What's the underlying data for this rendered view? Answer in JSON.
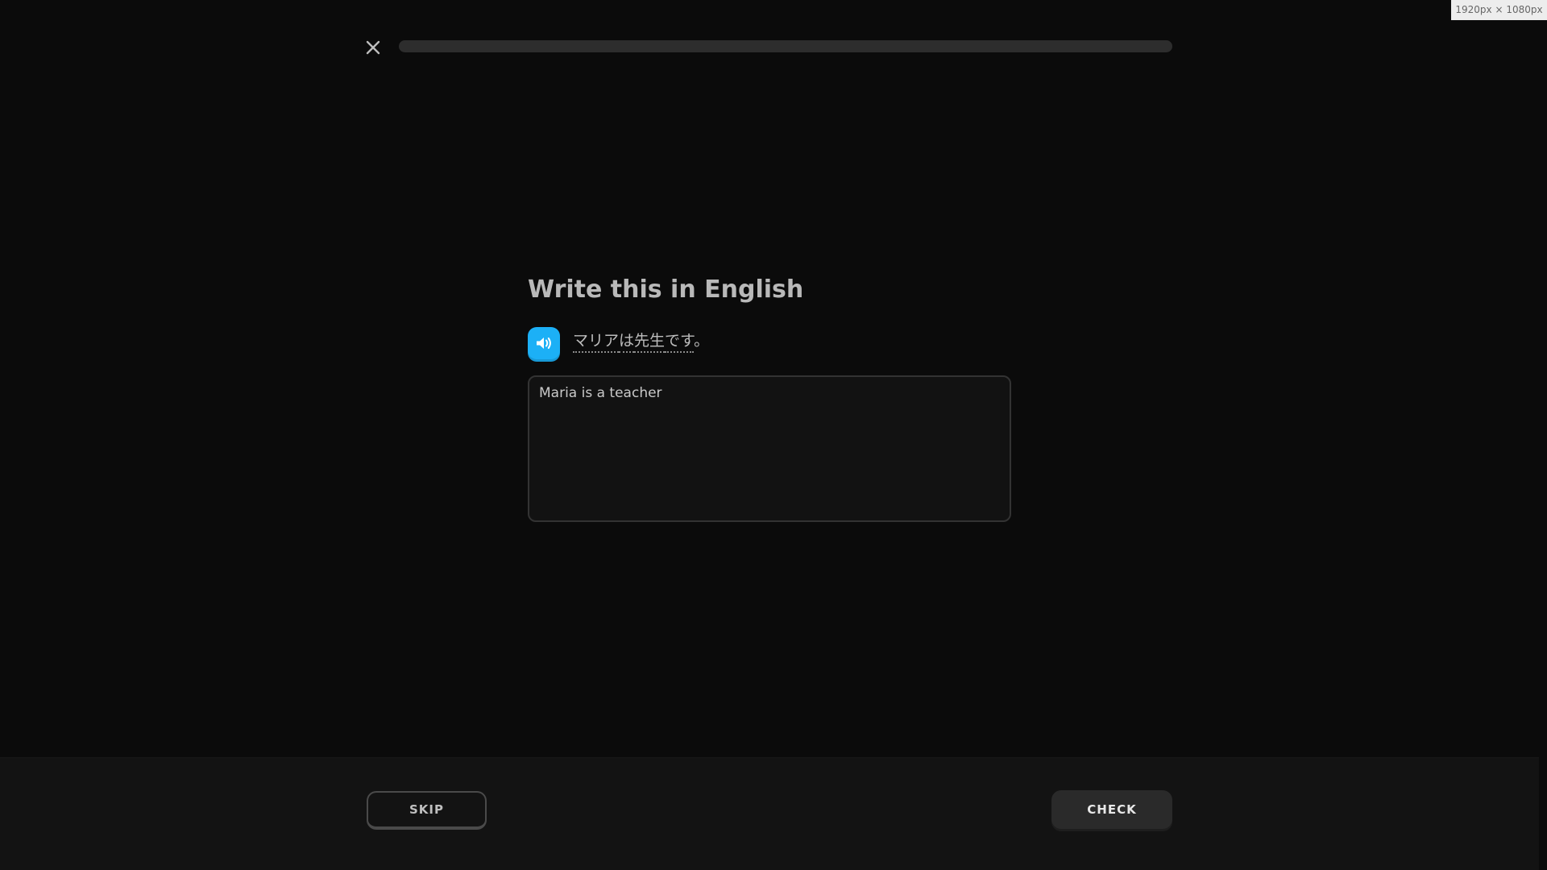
{
  "window": {
    "size_badge": "1920px × 1080px"
  },
  "header": {
    "close_icon": "close-icon",
    "progress": 0
  },
  "prompt": {
    "title": "Write this in English",
    "audio_icon": "speaker-icon",
    "sentence_words": [
      "マリア",
      "は",
      "先生",
      "です"
    ],
    "sentence_end": "。"
  },
  "answer": {
    "value": "Maria is a teacher",
    "placeholder": ""
  },
  "footer": {
    "skip_label": "SKIP",
    "check_label": "CHECK"
  },
  "colors": {
    "background": "#0b0b0b",
    "accent_blue": "#1cb0f6",
    "progress_track": "#2d2d2d"
  }
}
